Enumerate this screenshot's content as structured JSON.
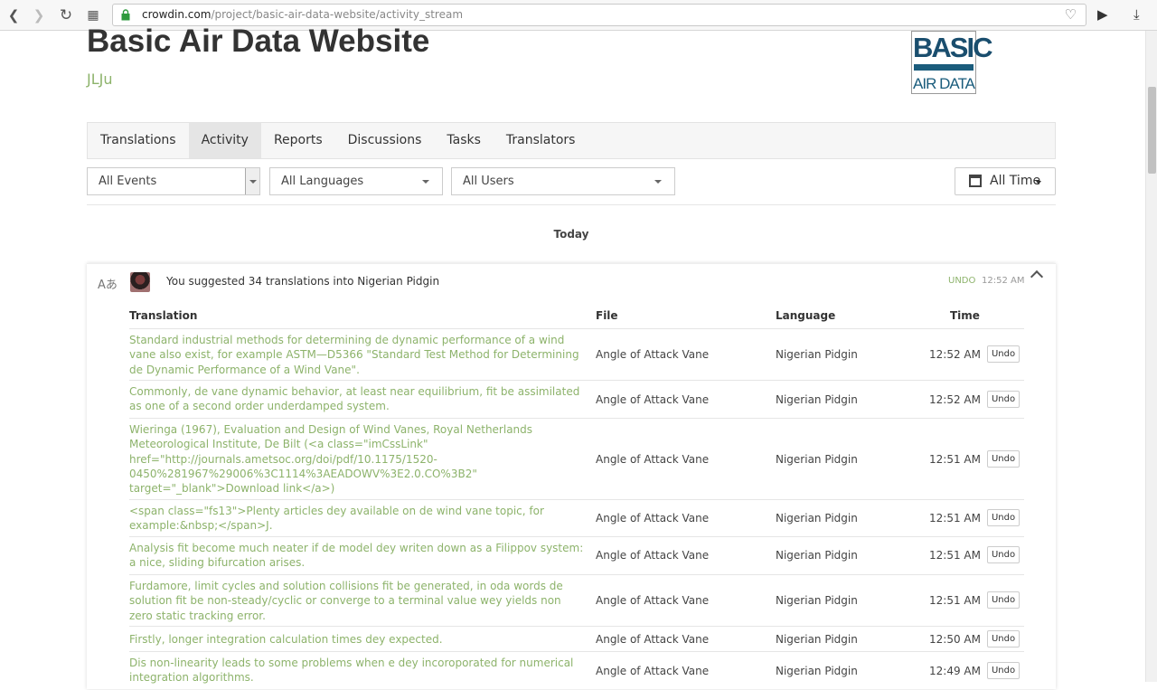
{
  "browser": {
    "url_domain": "crowdin.com",
    "url_path": "/project/basic-air-data-website/activity_stream"
  },
  "project": {
    "title": "Basic Air Data Website",
    "owner": "JLJu",
    "logo_line1": "BASIC",
    "logo_line2": "AIR DATA"
  },
  "tabs": [
    "Translations",
    "Activity",
    "Reports",
    "Discussions",
    "Tasks",
    "Translators"
  ],
  "filters": {
    "events": "All Events",
    "languages": "All Languages",
    "users": "All Users",
    "time": "All Time"
  },
  "day_label": "Today",
  "activity": {
    "summary": "You suggested 34 translations into Nigerian Pidgin",
    "undo_label": "UNDO",
    "time": "12:52 AM",
    "columns": {
      "translation": "Translation",
      "file": "File",
      "language": "Language",
      "time": "Time"
    },
    "rows": [
      {
        "translation": "Standard industrial methods for determining de dynamic performance of a wind vane also exist, for example ASTM—D5366 \"Standard Test Method for Determining de Dynamic Performance of a Wind Vane\".",
        "file": "Angle of Attack Vane",
        "language": "Nigerian Pidgin",
        "time": "12:52 AM",
        "action": "Undo"
      },
      {
        "translation": "Commonly, de vane dynamic behavior, at least near equilibrium, fit be assimilated as one of a second order underdamped system.",
        "file": "Angle of Attack Vane",
        "language": "Nigerian Pidgin",
        "time": "12:52 AM",
        "action": "Undo"
      },
      {
        "translation": "Wieringa (1967), Evaluation and Design of Wind Vanes, Royal Netherlands Meteorological Institute, De Bilt (<a class=\"imCssLink\" href=\"http://journals.ametsoc.org/doi/pdf/10.1175/1520-0450%281967%29006%3C1114%3AEADOWV%3E2.0.CO%3B2\" target=\"_blank\">Download link</a>)",
        "file": "Angle of Attack Vane",
        "language": "Nigerian Pidgin",
        "time": "12:51 AM",
        "action": "Undo"
      },
      {
        "translation": "<span class=\"fs13\">Plenty articles dey available on de wind vane topic, for example:&nbsp;</span>J.",
        "file": "Angle of Attack Vane",
        "language": "Nigerian Pidgin",
        "time": "12:51 AM",
        "action": "Undo"
      },
      {
        "translation": "Analysis fit become much neater if de model dey writen down as a Filippov system: a nice, sliding bifurcation arises.",
        "file": "Angle of Attack Vane",
        "language": "Nigerian Pidgin",
        "time": "12:51 AM",
        "action": "Undo"
      },
      {
        "translation": "Furdamore, limit cycles and solution collisions fit be generated, in oda words de solution fit be non-steady/cyclic or converge to a terminal value wey yields non zero static tracking error.",
        "file": "Angle of Attack Vane",
        "language": "Nigerian Pidgin",
        "time": "12:51 AM",
        "action": "Undo"
      },
      {
        "translation": "Firstly, longer integration calculation times dey expected.",
        "file": "Angle of Attack Vane",
        "language": "Nigerian Pidgin",
        "time": "12:50 AM",
        "action": "Undo"
      },
      {
        "translation": "Dis non-linearity leads to some problems when e dey incoroporated for numerical integration algorithms.",
        "file": "Angle of Attack Vane",
        "language": "Nigerian Pidgin",
        "time": "12:49 AM",
        "action": "Undo"
      }
    ]
  }
}
